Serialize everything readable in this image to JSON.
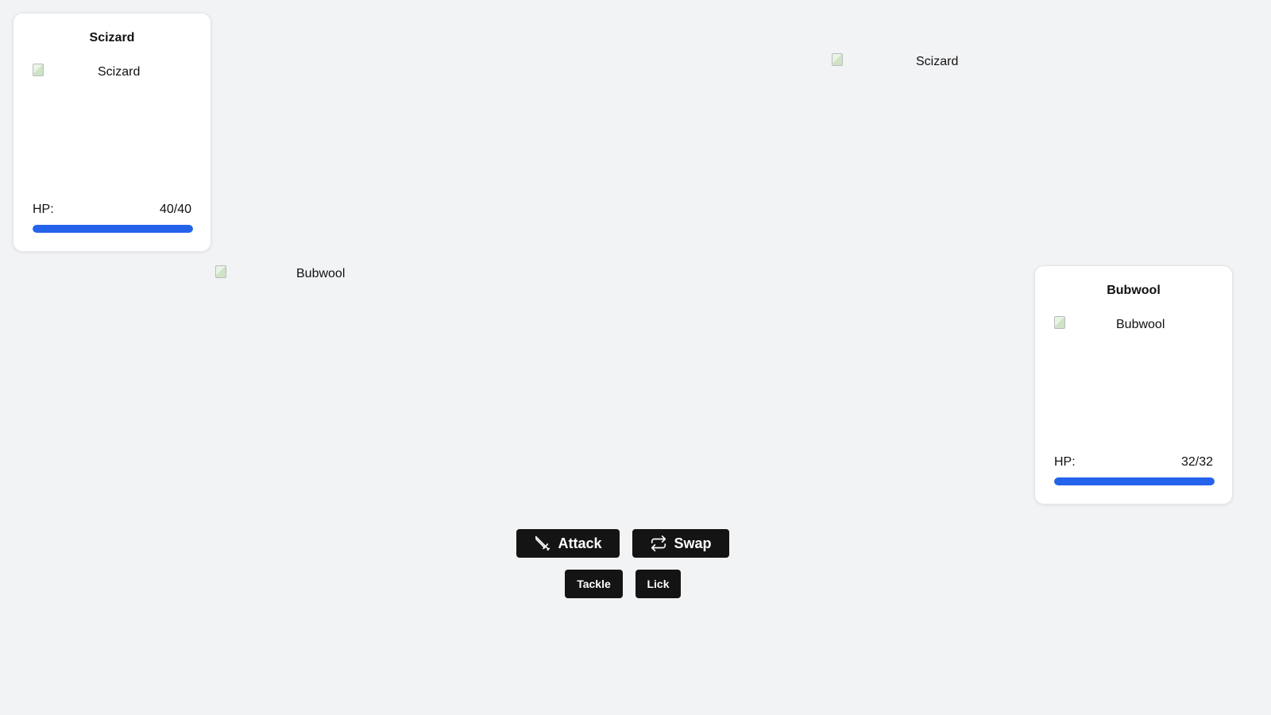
{
  "player_card": {
    "name": "Scizard",
    "image_alt": "Scizard",
    "hp_label": "HP:",
    "hp_text": "40/40",
    "hp_current": 40,
    "hp_max": 40
  },
  "opponent_card": {
    "name": "Bubwool",
    "image_alt": "Bubwool",
    "hp_label": "HP:",
    "hp_text": "32/32",
    "hp_current": 32,
    "hp_max": 32
  },
  "battlefield": {
    "top_sprite_alt": "Scizard",
    "bottom_sprite_alt": "Bubwool"
  },
  "actions": {
    "attack_label": "Attack",
    "swap_label": "Swap",
    "attack_icon": "sword-icon",
    "swap_icon": "swap-arrows-icon"
  },
  "moves": [
    {
      "label": "Tackle"
    },
    {
      "label": "Lick"
    }
  ],
  "colors": {
    "background": "#f2f3f5",
    "hp_bar": "#2563eb",
    "button": "#141414"
  }
}
